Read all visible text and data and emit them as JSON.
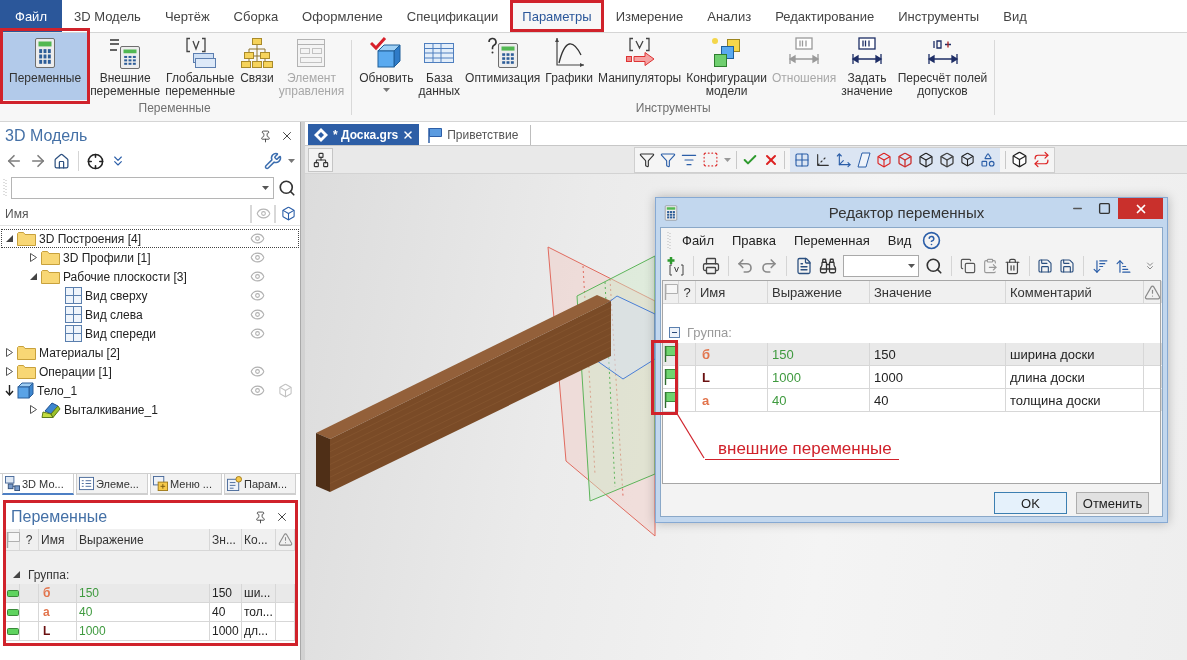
{
  "ribbon": {
    "tabs": [
      {
        "label": "Файл",
        "kind": "file",
        "selected": false,
        "highlighted": false
      },
      {
        "label": "3D Модель",
        "kind": "tab",
        "selected": false,
        "highlighted": false
      },
      {
        "label": "Чертёж",
        "kind": "tab",
        "selected": false,
        "highlighted": false
      },
      {
        "label": "Сборка",
        "kind": "tab",
        "selected": false,
        "highlighted": false
      },
      {
        "label": "Оформление",
        "kind": "tab",
        "selected": false,
        "highlighted": false
      },
      {
        "label": "Спецификации",
        "kind": "tab",
        "selected": false,
        "highlighted": false
      },
      {
        "label": "Параметры",
        "kind": "tab",
        "selected": true,
        "highlighted": true
      },
      {
        "label": "Измерение",
        "kind": "tab",
        "selected": false,
        "highlighted": false
      },
      {
        "label": "Анализ",
        "kind": "tab",
        "selected": false,
        "highlighted": false
      },
      {
        "label": "Редактирование",
        "kind": "tab",
        "selected": false,
        "highlighted": false
      },
      {
        "label": "Инструменты",
        "kind": "tab",
        "selected": false,
        "highlighted": false
      },
      {
        "label": "Вид",
        "kind": "tab",
        "selected": false,
        "highlighted": false
      }
    ],
    "groups": [
      {
        "label": "Переменные",
        "buttons": [
          {
            "label": "Переменные",
            "selected": true,
            "disabled": false,
            "dropdown": false,
            "highlighted": true
          },
          {
            "label": "Внешние\nпеременные",
            "selected": false,
            "disabled": false,
            "dropdown": false,
            "highlighted": false
          },
          {
            "label": "Глобальные\nпеременные",
            "selected": false,
            "disabled": false,
            "dropdown": false,
            "highlighted": false
          },
          {
            "label": "Связи",
            "selected": false,
            "disabled": false,
            "dropdown": false,
            "highlighted": false
          },
          {
            "label": "Элемент\nуправления",
            "selected": false,
            "disabled": true,
            "dropdown": false,
            "highlighted": false
          }
        ]
      },
      {
        "label": "Инструменты",
        "buttons": [
          {
            "label": "Обновить",
            "selected": false,
            "disabled": false,
            "dropdown": true,
            "highlighted": false
          },
          {
            "label": "База\nданных",
            "selected": false,
            "disabled": false,
            "dropdown": false,
            "highlighted": false
          },
          {
            "label": "Оптимизация",
            "selected": false,
            "disabled": false,
            "dropdown": false,
            "highlighted": false
          },
          {
            "label": "Графики",
            "selected": false,
            "disabled": false,
            "dropdown": false,
            "highlighted": false
          },
          {
            "label": "Манипуляторы",
            "selected": false,
            "disabled": false,
            "dropdown": false,
            "highlighted": false
          },
          {
            "label": "Конфигурации\nмодели",
            "selected": false,
            "disabled": false,
            "dropdown": false,
            "highlighted": false
          },
          {
            "label": "Отношения",
            "selected": false,
            "disabled": true,
            "dropdown": false,
            "highlighted": false
          },
          {
            "label": "Задать\nзначение",
            "selected": false,
            "disabled": false,
            "dropdown": false,
            "highlighted": false
          },
          {
            "label": "Пересчёт полей\nдопусков",
            "selected": false,
            "disabled": false,
            "dropdown": false,
            "highlighted": false
          }
        ]
      }
    ]
  },
  "model_panel": {
    "title": "3D Модель",
    "column": "Имя",
    "tree": [
      {
        "label": "3D Построения [4]",
        "kind": "folder",
        "expanded": true,
        "focused": true,
        "eye": true,
        "cube": false,
        "children": [
          {
            "label": "3D Профили [1]",
            "kind": "folder",
            "expanded": false,
            "focused": false,
            "eye": true,
            "cube": false
          },
          {
            "label": "Рабочие плоскости [3]",
            "kind": "folder",
            "expanded": true,
            "focused": false,
            "eye": true,
            "cube": false,
            "children": [
              {
                "label": "Вид сверху",
                "kind": "plane",
                "focused": false,
                "eye": true,
                "cube": false
              },
              {
                "label": "Вид слева",
                "kind": "plane",
                "focused": false,
                "eye": true,
                "cube": false
              },
              {
                "label": "Вид спереди",
                "kind": "plane",
                "focused": false,
                "eye": true,
                "cube": false
              }
            ]
          }
        ]
      },
      {
        "label": "Материалы [2]",
        "kind": "folder",
        "expanded": false,
        "focused": false,
        "eye": false,
        "cube": false
      },
      {
        "label": "Операции [1]",
        "kind": "folder",
        "expanded": false,
        "focused": false,
        "eye": true,
        "cube": false
      },
      {
        "label": "Тело_1",
        "kind": "body",
        "expanded": true,
        "focused": false,
        "eye": true,
        "cube": true,
        "children": [
          {
            "label": "Выталкивание_1",
            "kind": "operation",
            "expanded": false,
            "focused": false,
            "eye": false,
            "cube": false
          }
        ]
      }
    ]
  },
  "bottom_tabs": [
    {
      "label": "3D Мо...",
      "selected": true
    },
    {
      "label": "Элеме...",
      "selected": false
    },
    {
      "label": "Меню ...",
      "selected": false
    },
    {
      "label": "Парам...",
      "selected": false
    }
  ],
  "variables_panel": {
    "title": "Переменные",
    "highlighted": true,
    "columns": [
      "?",
      "Имя",
      "Выражение",
      "Зн...",
      "Ко..."
    ],
    "group": {
      "label": "Группа:",
      "expanded": true
    },
    "rows": [
      {
        "name": "б",
        "color": "#e2744c",
        "expression": "150",
        "value": "150",
        "comment": "ши...",
        "external": true,
        "selected": true
      },
      {
        "name": "а",
        "color": "#e2744c",
        "expression": "40",
        "value": "40",
        "comment": "тол...",
        "external": true,
        "selected": false
      },
      {
        "name": "L",
        "color": "#6a1010",
        "expression": "1000",
        "value": "1000",
        "comment": "дл...",
        "external": true,
        "selected": false
      }
    ]
  },
  "documents": {
    "tabs": [
      {
        "label": "* Доска.grs",
        "selected": true
      },
      {
        "label": "Приветствие",
        "selected": false
      }
    ]
  },
  "dialog": {
    "title": "Редактор переменных",
    "menu": [
      "Файл",
      "Правка",
      "Переменная",
      "Вид"
    ],
    "columns": [
      "?",
      "Имя",
      "Выражение",
      "Значение",
      "Комментарий"
    ],
    "group": {
      "label": "Группа:",
      "expanded": true
    },
    "flags_highlighted": true,
    "rows": [
      {
        "name": "б",
        "color": "#e2744c",
        "expression": "150",
        "value": "150",
        "comment": "ширина доски",
        "external": true,
        "selected": true
      },
      {
        "name": "L",
        "color": "#6a1010",
        "expression": "1000",
        "value": "1000",
        "comment": "длина доски",
        "external": true,
        "selected": false
      },
      {
        "name": "а",
        "color": "#e2744c",
        "expression": "40",
        "value": "40",
        "comment": "толщина доски",
        "external": true,
        "selected": false
      }
    ],
    "buttons": [
      {
        "label": "OK",
        "default": true
      },
      {
        "label": "Отменить",
        "default": false
      }
    ]
  },
  "annotation": {
    "text": "внешние переменные"
  }
}
